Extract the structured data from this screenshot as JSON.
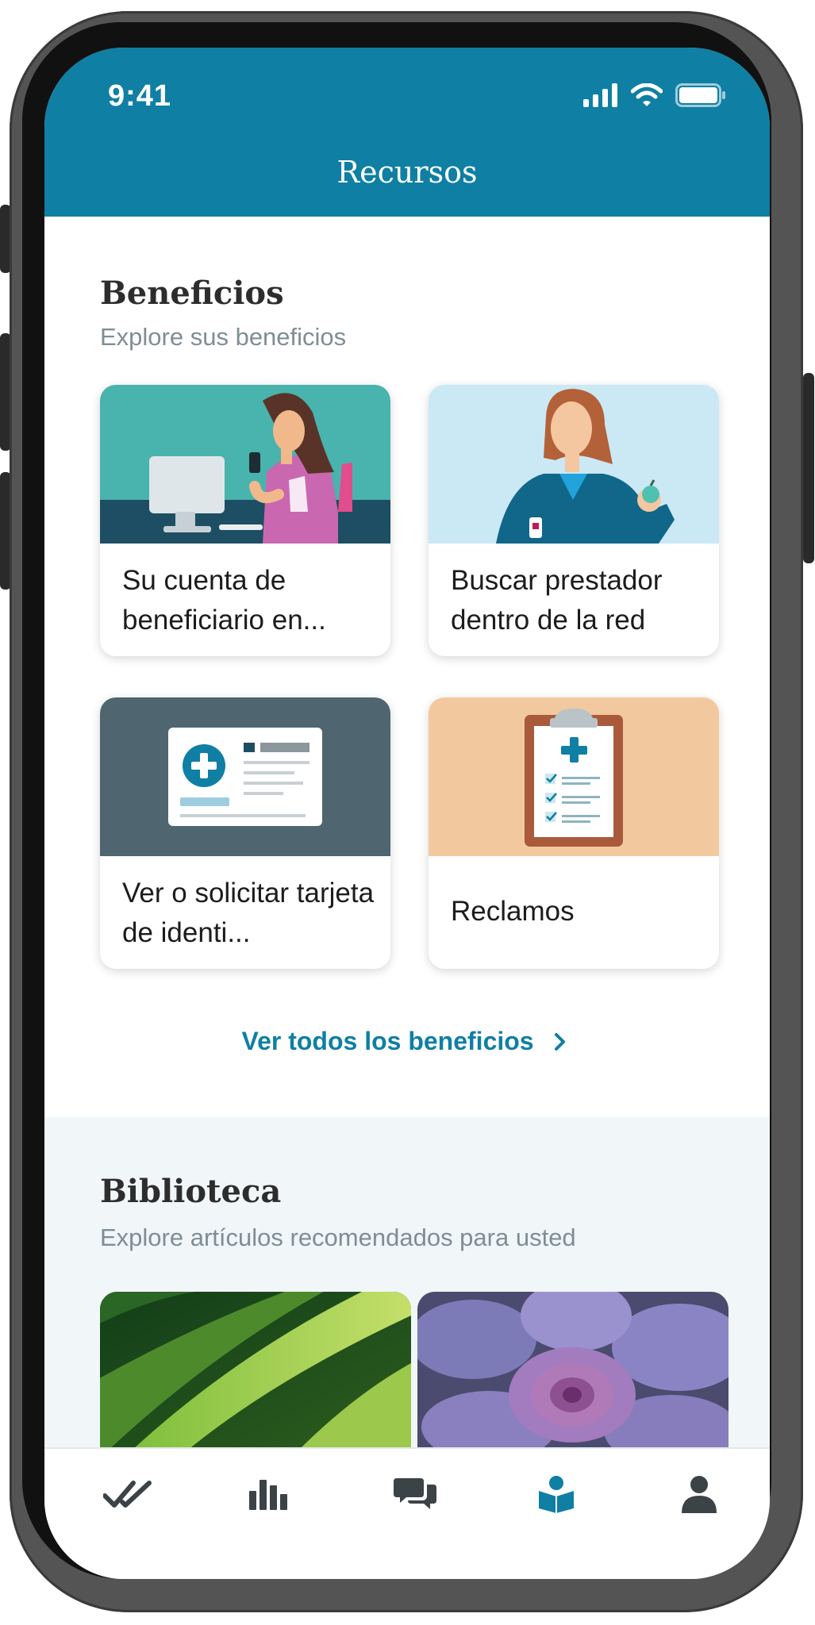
{
  "status_bar": {
    "time": "9:41"
  },
  "header": {
    "title": "Recursos"
  },
  "benefits": {
    "title": "Beneficios",
    "subtitle": "Explore sus beneficios",
    "cards": [
      {
        "label": "Su cuenta de beneficiario en...",
        "image": "woman-at-computer-illustration"
      },
      {
        "label": "Buscar prestador dentro de la red",
        "image": "doctor-with-apple-illustration"
      },
      {
        "label": "Ver o solicitar tarjeta de identi...",
        "image": "id-card-illustration"
      },
      {
        "label": "Reclamos",
        "image": "clipboard-illustration"
      }
    ],
    "see_all": "Ver todos los beneficios"
  },
  "library": {
    "title": "Biblioteca",
    "subtitle": "Explore artículos recomendados para usted",
    "photos": [
      "green-leaves-photo",
      "purple-succulent-photo"
    ]
  },
  "tabbar": {
    "items": [
      {
        "icon": "double-check-icon"
      },
      {
        "icon": "bar-chart-icon"
      },
      {
        "icon": "chat-bubbles-icon"
      },
      {
        "icon": "book-person-icon",
        "active": true
      },
      {
        "icon": "person-icon"
      }
    ]
  },
  "colors": {
    "brand": "#0f7fa4",
    "library_bg": "#f1f6f9",
    "inactive_icon": "#3b4347"
  }
}
